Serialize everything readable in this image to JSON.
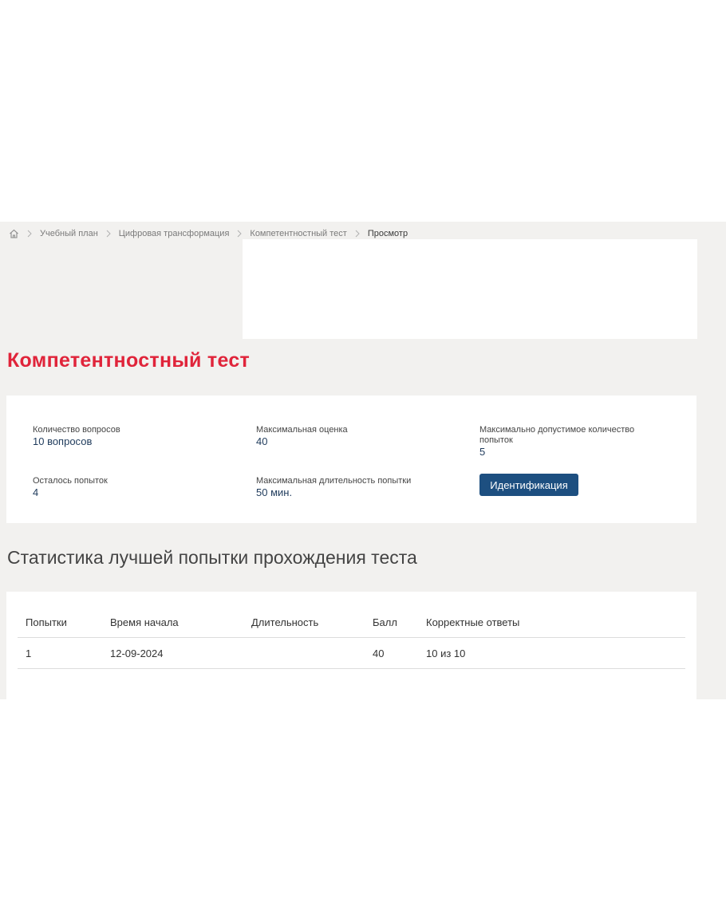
{
  "breadcrumb": {
    "home_icon": "home-icon",
    "items": [
      {
        "label": "Учебный план"
      },
      {
        "label": "Цифровая трансформация"
      },
      {
        "label": "Компетентностный тест"
      }
    ],
    "current": "Просмотр"
  },
  "page": {
    "title": "Компетентностный тест",
    "accent_color": "#e0243a"
  },
  "info": {
    "questions_label": "Количество вопросов",
    "questions_value": "10 вопросов",
    "max_score_label": "Максимальная оценка",
    "max_score_value": "40",
    "max_attempts_label": "Максимально допустимое количество попыток",
    "max_attempts_value": "5",
    "attempts_left_label": "Осталось попыток",
    "attempts_left_value": "4",
    "max_duration_label": "Максимальная длительность попытки",
    "max_duration_value": "50 мин.",
    "identify_button": "Идентификация",
    "button_color": "#1d4f80"
  },
  "stats": {
    "title": "Статистика лучшей попытки прохождения теста",
    "columns": [
      "Попытки",
      "Время начала",
      "Длительность",
      "Балл",
      "Корректные ответы"
    ],
    "rows": [
      [
        "1",
        "12-09-2024",
        "",
        "40",
        "10 из 10"
      ]
    ]
  }
}
